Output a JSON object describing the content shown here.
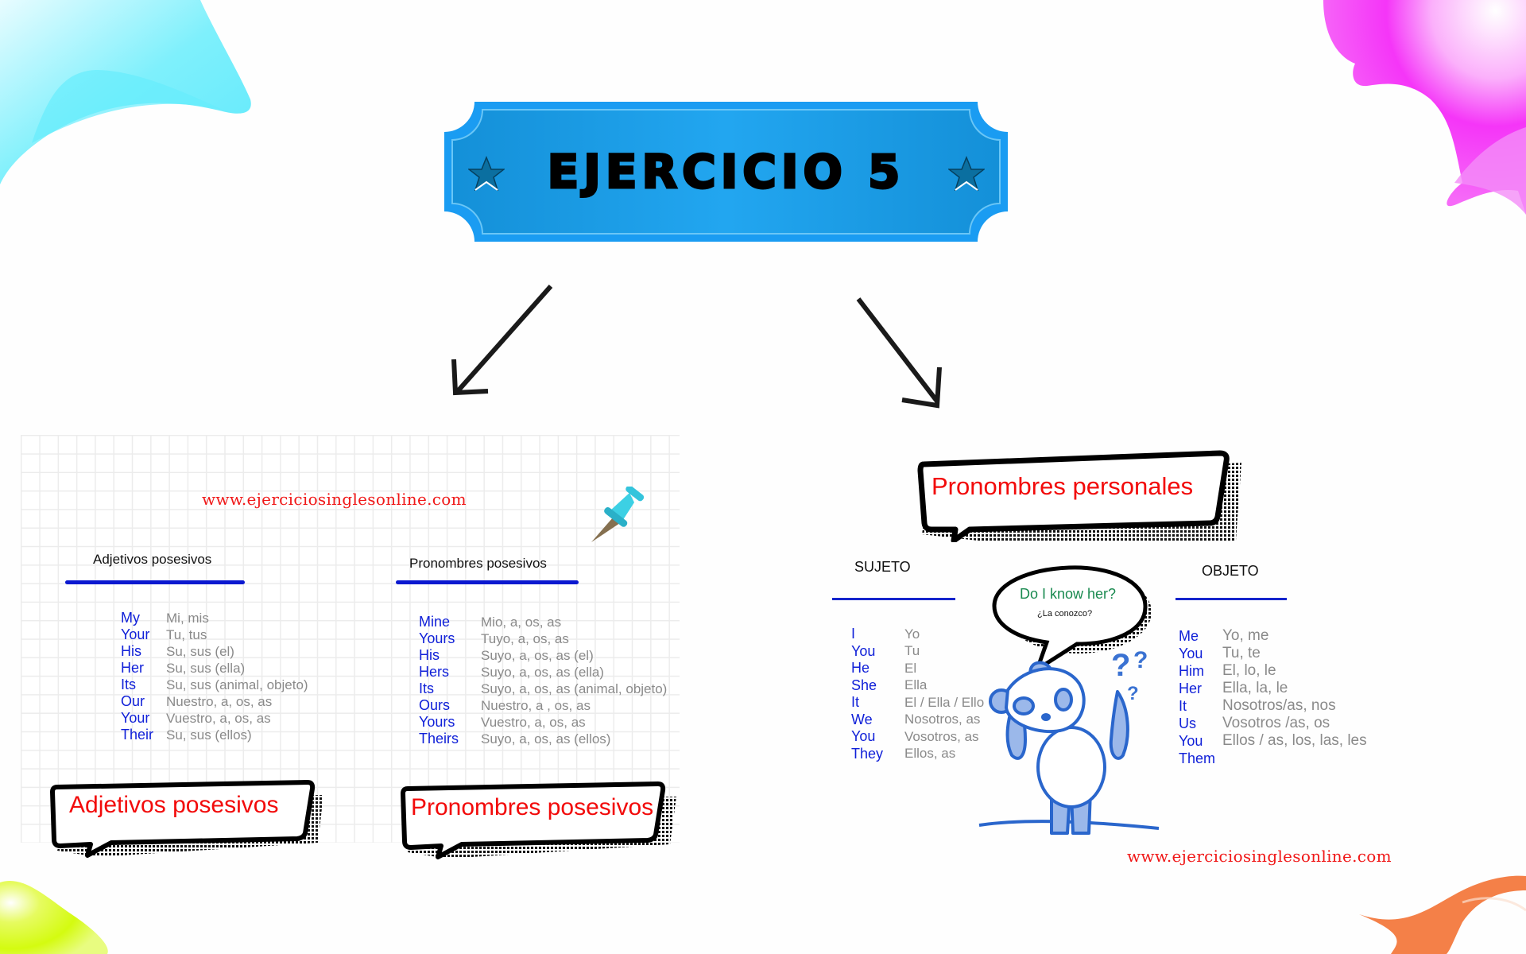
{
  "banner": {
    "title": "EJERCICIO 5",
    "color": "#1ea0ee",
    "left_icon": "star-icon",
    "right_icon": "star-icon"
  },
  "arrows": [
    "arrow-down-left-icon",
    "arrow-down-right-icon"
  ],
  "left_panel": {
    "site_url": "www.ejerciciosinglesonline.com",
    "pin_icon": "pushpin-icon",
    "adjectives": {
      "heading": "Adjetivos posesivos",
      "rows": [
        {
          "en": "My",
          "es": "Mi, mis"
        },
        {
          "en": "Your",
          "es": "Tu, tus"
        },
        {
          "en": "His",
          "es": "Su, sus (el)"
        },
        {
          "en": "Her",
          "es": "Su, sus (ella)"
        },
        {
          "en": "Its",
          "es": "Su, sus (animal, objeto)"
        },
        {
          "en": "Our",
          "es": "Nuestro, a, os, as"
        },
        {
          "en": "Your",
          "es": "Vuestro, a, os, as"
        },
        {
          "en": "Their",
          "es": "Su, sus (ellos)"
        }
      ],
      "bubble_label": "Adjetivos posesivos"
    },
    "pronouns": {
      "heading": "Pronombres posesivos",
      "rows": [
        {
          "en": "Mine",
          "es": "Mio, a, os, as"
        },
        {
          "en": "Yours",
          "es": "Tuyo, a, os, as"
        },
        {
          "en": "His",
          "es": "Suyo, a, os, as (el)"
        },
        {
          "en": "Hers",
          "es": "Suyo, a, os, as (ella)"
        },
        {
          "en": "Its",
          "es": "Suyo, a, os, as (animal, objeto)"
        },
        {
          "en": "Ours",
          "es": "Nuestro, a , os, as"
        },
        {
          "en": "Yours",
          "es": "Vuestro, a, os, as"
        },
        {
          "en": "Theirs",
          "es": "Suyo, a, os, as (ellos)"
        }
      ],
      "bubble_label": "Pronombres posesivos"
    }
  },
  "right_panel": {
    "bubble_label": "Pronombres personales",
    "subject": {
      "heading": "SUJETO",
      "rows": [
        {
          "en": "I",
          "es": "Yo"
        },
        {
          "en": "You",
          "es": "Tu"
        },
        {
          "en": "He",
          "es": "El"
        },
        {
          "en": "She",
          "es": "Ella"
        },
        {
          "en": "It",
          "es": "El / Ella / Ello"
        },
        {
          "en": "We",
          "es": "Nosotros, as"
        },
        {
          "en": "You",
          "es": "Vosotros, as"
        },
        {
          "en": "They",
          "es": "Ellos, as"
        }
      ]
    },
    "object": {
      "heading": "OBJETO",
      "rows": [
        {
          "en": "Me",
          "es": "Yo, me"
        },
        {
          "en": "You",
          "es": "Tu, te"
        },
        {
          "en": "Him",
          "es": "El, lo, le"
        },
        {
          "en": "Her",
          "es": "Ella, la, le"
        },
        {
          "en": "It",
          "es": "Nosotros/as, nos"
        },
        {
          "en": "Us",
          "es": "Vosotros /as, os"
        },
        {
          "en": "You",
          "es": "Ellos / as, los, las, les"
        },
        {
          "en": "Them",
          "es": ""
        }
      ]
    },
    "speech": {
      "question": "Do I know her?",
      "translation": "¿La conozco?",
      "marks": "???"
    },
    "character_icon": "confused-panda-icon",
    "site_url": "www.ejerciciosinglesonline.com"
  },
  "decorations": {
    "top_left": "#6eeefc",
    "top_right": "#f52cf8",
    "bottom_left": "#d8fa10",
    "bottom_right": "#f2601e"
  }
}
